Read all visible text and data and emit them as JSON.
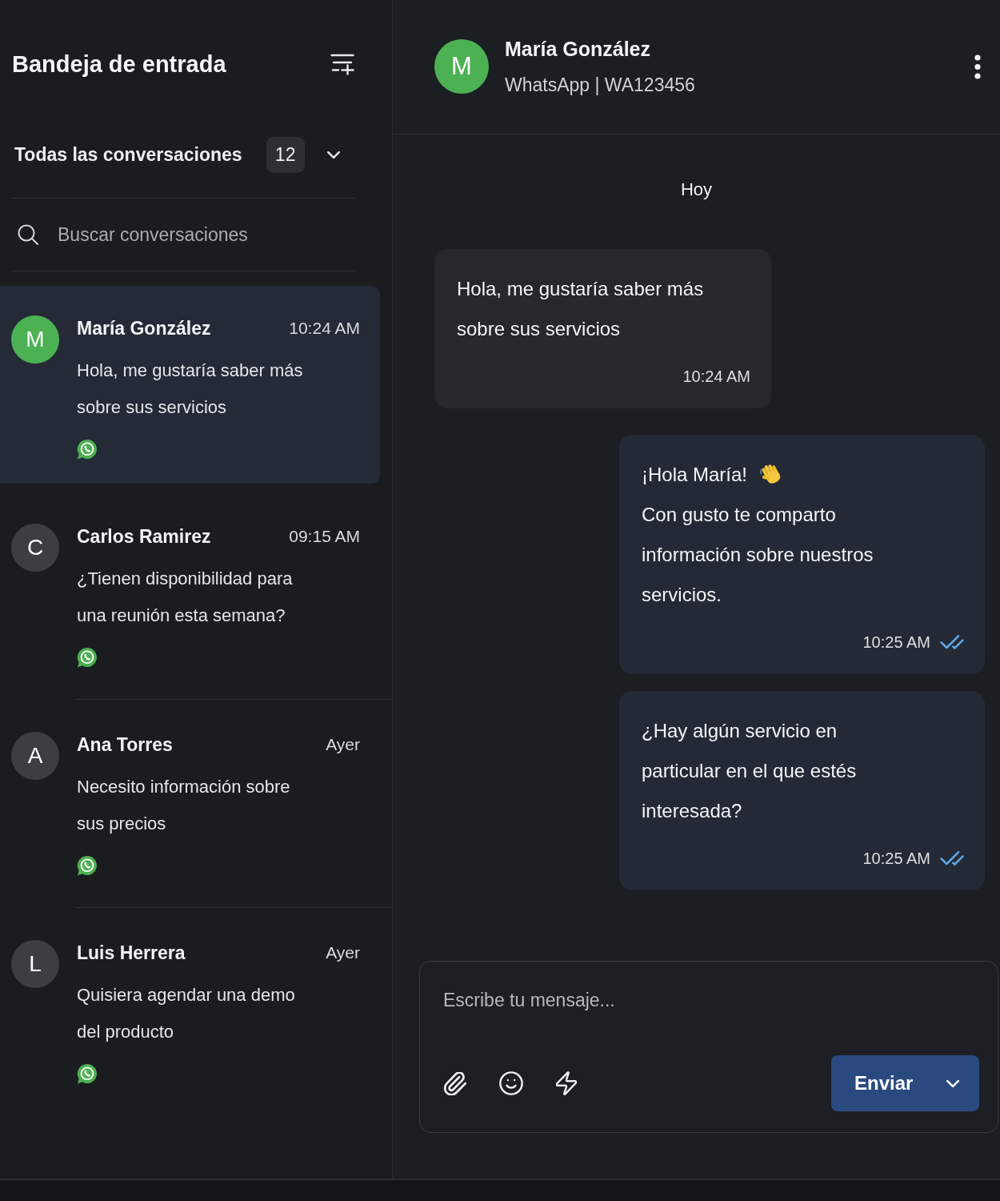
{
  "sidebar": {
    "title": "Bandeja de entrada",
    "filter": {
      "label": "Todas las conversaciones",
      "count": "12"
    },
    "search": {
      "placeholder": "Buscar conversaciones"
    },
    "conversations": [
      {
        "initial": "M",
        "color": "#4cb152",
        "name": "María González",
        "time": "10:24 AM",
        "preview": "Hola, me gustaría saber más sobre sus servicios",
        "selected": true
      },
      {
        "initial": "C",
        "color": "#3b3e43",
        "name": "Carlos Ramirez",
        "time": "09:15 AM",
        "preview": "¿Tienen disponibilidad para una reunión esta semana?",
        "selected": false
      },
      {
        "initial": "A",
        "color": "#3b3e43",
        "name": "Ana Torres",
        "time": "Ayer",
        "preview": "Necesito información sobre sus precios",
        "selected": false
      },
      {
        "initial": "L",
        "color": "#3b3e43",
        "name": "Luis Herrera",
        "time": "Ayer",
        "preview": "Quisiera agendar una demo del producto",
        "selected": false
      }
    ]
  },
  "chat": {
    "contact": {
      "initial": "M",
      "color": "#4cb152",
      "name": "María González",
      "subtitle": "WhatsApp | WA123456"
    },
    "date_label": "Hoy",
    "messages": [
      {
        "kind": "incoming",
        "paragraphs": [
          {
            "kind": "text",
            "text": "Hola, me gustaría saber más sobre sus servicios"
          }
        ],
        "time": "10:24 AM"
      },
      {
        "kind": "outgoing",
        "paragraphs": [
          {
            "kind": "wave",
            "text": "¡Hola María!"
          },
          {
            "kind": "text",
            "text": "Con gusto te comparto información sobre nuestros servicios."
          }
        ],
        "time": "10:25 AM",
        "read": true
      },
      {
        "kind": "outgoing",
        "paragraphs": [
          {
            "kind": "text",
            "text": "¿Hay algún servicio en particular en el que estés interesada?"
          }
        ],
        "time": "10:25 AM",
        "read": true
      }
    ],
    "composer": {
      "placeholder": "Escribe tu mensaje...",
      "send_label": "Enviar"
    }
  }
}
